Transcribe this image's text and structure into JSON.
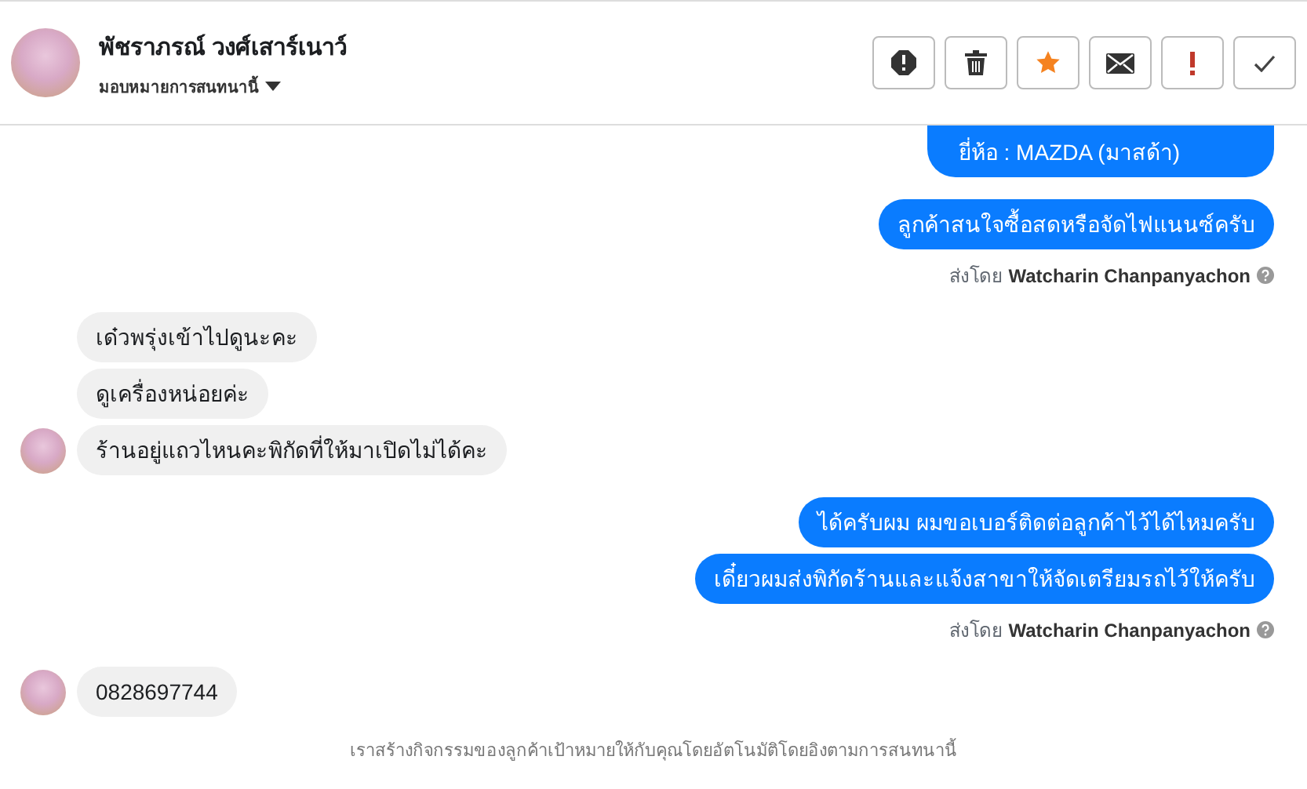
{
  "header": {
    "name": "พัชราภรณ์ วงศ์เสาร์เนาว์",
    "assign_label": "มอบหมายการสนทนานี้"
  },
  "actions": [
    {
      "kind": "alert"
    },
    {
      "kind": "trash"
    },
    {
      "kind": "star"
    },
    {
      "kind": "mail"
    },
    {
      "kind": "bang"
    },
    {
      "kind": "check"
    }
  ],
  "groups": [
    {
      "kind": "outgoing",
      "messages": [
        "ยี่ห้อ : MAZDA (มาสด้า)"
      ],
      "clipped_top": true
    },
    {
      "kind": "outgoing",
      "messages": [
        "ลูกค้าสนใจซื้อสดหรือจัดไฟแนนซ์ครับ"
      ],
      "sent_by_label": "ส่งโดย",
      "sent_by": "Watcharin Chanpanyachon"
    },
    {
      "kind": "incoming",
      "messages": [
        "เด๋วพรุ่งเข้าไปดูนะคะ",
        "ดูเครื่องหน่อยค่ะ",
        "ร้านอยู่แถวไหนคะพิกัดที่ให้มาเปิดไม่ได้คะ"
      ]
    },
    {
      "kind": "outgoing",
      "messages": [
        "ได้ครับผม ผมขอเบอร์ติดต่อลูกค้าไว้ได้ไหมครับ",
        "เดี๋ยวผมส่งพิกัดร้านและแจ้งสาขาให้จัดเตรียมรถไว้ให้ครับ"
      ],
      "sent_by_label": "ส่งโดย",
      "sent_by": "Watcharin Chanpanyachon"
    },
    {
      "kind": "incoming",
      "messages": [
        "0828697744"
      ]
    }
  ],
  "footer": "เราสร้างกิจกรรมของลูกค้าเป้าหมายให้กับคุณโดยอัตโนมัติโดยอิงตามการสนทนานี้"
}
